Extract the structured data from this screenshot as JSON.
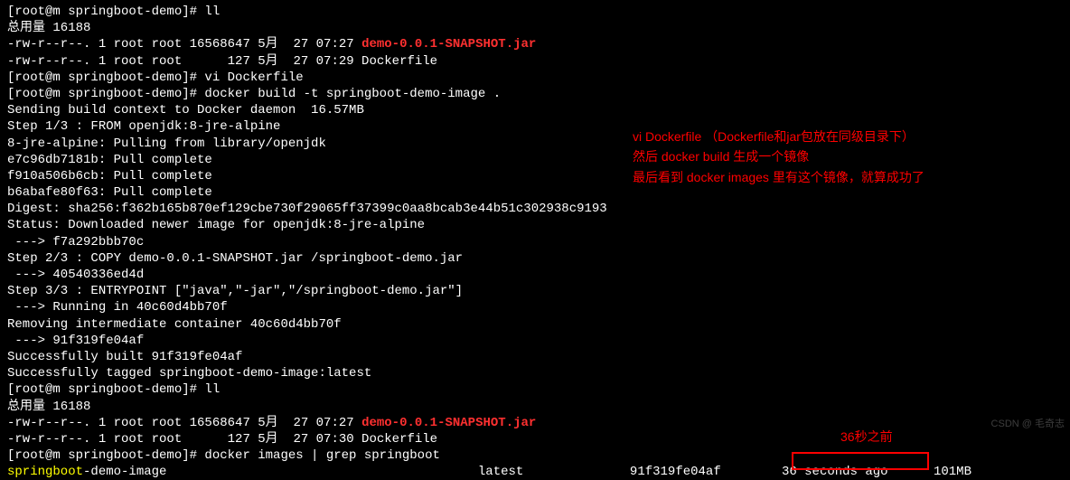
{
  "lines": {
    "l01a": "[root@m springboot-demo]# ll",
    "l02": "总用量 16188",
    "l03a": "-rw-r--r--. 1 root root 16568647 5月  27 07:27 ",
    "l03b": "demo-0.0.1-SNAPSHOT.jar",
    "l04": "-rw-r--r--. 1 root root      127 5月  27 07:29 Dockerfile",
    "l05": "[root@m springboot-demo]# vi Dockerfile",
    "l06": "[root@m springboot-demo]# docker build -t springboot-demo-image .",
    "l07": "Sending build context to Docker daemon  16.57MB",
    "l08": "Step 1/3 : FROM openjdk:8-jre-alpine",
    "l09": "8-jre-alpine: Pulling from library/openjdk",
    "l10": "e7c96db7181b: Pull complete",
    "l11": "f910a506b6cb: Pull complete",
    "l12": "b6abafe80f63: Pull complete",
    "l13": "Digest: sha256:f362b165b870ef129cbe730f29065ff37399c0aa8bcab3e44b51c302938c9193",
    "l14": "Status: Downloaded newer image for openjdk:8-jre-alpine",
    "l15": " ---> f7a292bbb70c",
    "l16": "Step 2/3 : COPY demo-0.0.1-SNAPSHOT.jar /springboot-demo.jar",
    "l17": " ---> 40540336ed4d",
    "l18": "Step 3/3 : ENTRYPOINT [\"java\",\"-jar\",\"/springboot-demo.jar\"]",
    "l19": " ---> Running in 40c60d4bb70f",
    "l20": "Removing intermediate container 40c60d4bb70f",
    "l21": " ---> 91f319fe04af",
    "l22": "Successfully built 91f319fe04af",
    "l23": "Successfully tagged springboot-demo-image:latest",
    "l24": "[root@m springboot-demo]# ll",
    "l25": "总用量 16188",
    "l26a": "-rw-r--r--. 1 root root 16568647 5月  27 07:27 ",
    "l26b": "demo-0.0.1-SNAPSHOT.jar",
    "l27": "-rw-r--r--. 1 root root      127 5月  27 07:30 Dockerfile",
    "l28": "[root@m springboot-demo]# docker images | grep springboot",
    "l29a": "springboot",
    "l29b": "-demo-image                                         latest              91f319fe04af        36 seconds ago      101MB"
  },
  "annotations": {
    "a1l1": "vi Dockerfile   （Dockerfile和jar包放在同级目录下）",
    "a1l2": "然后 docker build 生成一个镜像",
    "a1l3": "最后看到 docker images 里有这个镜像，就算成功了",
    "a2": "36秒之前"
  },
  "watermark": "CSDN @ 毛奇志"
}
